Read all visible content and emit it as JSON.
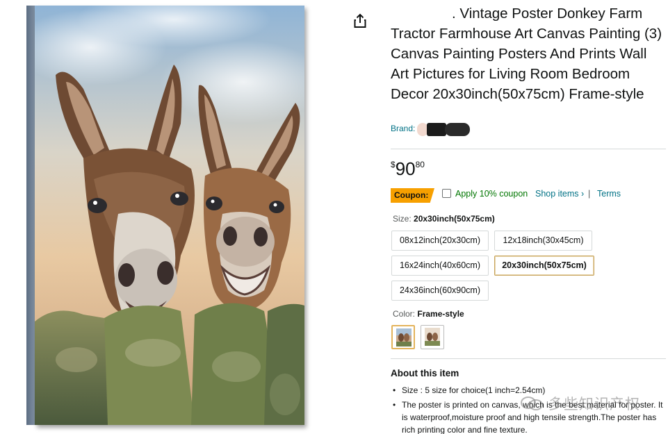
{
  "product": {
    "title": ". Vintage Poster Donkey Farm Tractor Farmhouse Art Canvas Painting (3) Canvas Painting Posters And Prints Wall Art Pictures for Living Room Bedroom Decor 20x30inch(50x75cm) Frame-style",
    "brand_label": "Brand:",
    "image_alt": "Painting of two donkeys leaning over a mossy stone wall",
    "share_icon": "share-icon"
  },
  "price": {
    "symbol": "$",
    "whole": "90",
    "fraction": "80"
  },
  "coupon": {
    "badge": "Coupon:",
    "apply_text": "Apply 10% coupon",
    "shop_items": "Shop items ›",
    "separator": "|",
    "terms": "Terms",
    "badge_color": "#f7a000",
    "text_color": "#007600"
  },
  "size": {
    "label": "Size:",
    "selected": "20x30inch(50x75cm)",
    "options": [
      "08x12inch(20x30cm)",
      "12x18inch(30x45cm)",
      "16x24inch(40x60cm)",
      "20x30inch(50x75cm)",
      "24x36inch(60x90cm)"
    ]
  },
  "color": {
    "label": "Color:",
    "selected": "Frame-style"
  },
  "about": {
    "title": "About this item",
    "bullets": [
      "Size : 5 size for choice(1 inch=2.54cm)",
      "The poster is printed on canvas, which is the best material for poster. It is waterproof,moisture proof and high tensile strength.The poster has rich printing color and fine texture."
    ]
  },
  "watermark": {
    "text": "多些知识产权"
  },
  "colors": {
    "link": "#007185",
    "selected_border": "#c7a35a"
  }
}
